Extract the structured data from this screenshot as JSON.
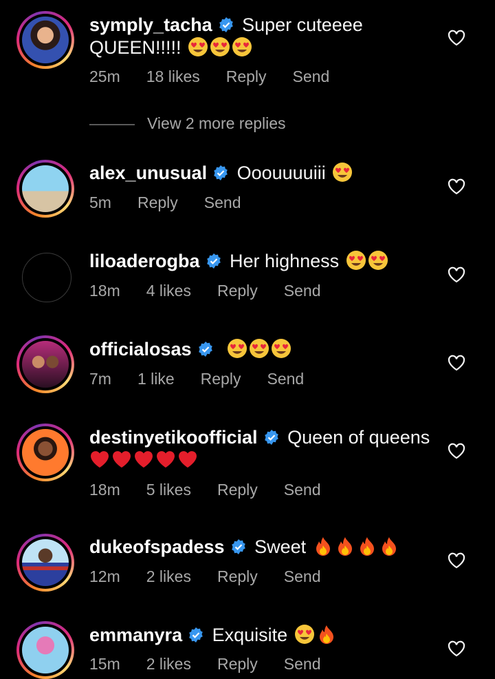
{
  "comments": [
    {
      "username": "symply_tacha",
      "text": "Super cuteeee QUEEN!!!!!",
      "emoji": [
        "heart-eyes",
        "heart-eyes",
        "heart-eyes"
      ],
      "time": "25m",
      "likes": "18 likes",
      "reply": "Reply",
      "send": "Send"
    },
    {
      "username": "alex_unusual",
      "text": "Ooouuuuiii",
      "emoji": [
        "heart-eyes"
      ],
      "time": "5m",
      "reply": "Reply",
      "send": "Send"
    },
    {
      "username": "liloaderogba",
      "text": "Her highness",
      "emoji": [
        "heart-eyes",
        "heart-eyes"
      ],
      "time": "18m",
      "likes": "4 likes",
      "reply": "Reply",
      "send": "Send"
    },
    {
      "username": "officialosas",
      "text": "",
      "emoji": [
        "heart-eyes",
        "heart-eyes",
        "heart-eyes"
      ],
      "time": "7m",
      "likes": "1 like",
      "reply": "Reply",
      "send": "Send"
    },
    {
      "username": "destinyetikoofficial",
      "text": "Queen of queens",
      "emoji": [
        "red-heart",
        "red-heart",
        "red-heart",
        "red-heart",
        "red-heart"
      ],
      "time": "18m",
      "likes": "5 likes",
      "reply": "Reply",
      "send": "Send"
    },
    {
      "username": "dukeofspadess",
      "text": "Sweet",
      "emoji": [
        "fire",
        "fire",
        "fire",
        "fire"
      ],
      "time": "12m",
      "likes": "2 likes",
      "reply": "Reply",
      "send": "Send"
    },
    {
      "username": "emmanyra",
      "text": "Exquisite",
      "emoji": [
        "heart-eyes",
        "fire"
      ],
      "time": "15m",
      "likes": "2 likes",
      "reply": "Reply",
      "send": "Send"
    }
  ],
  "view_replies": "View 2 more replies",
  "colors": {
    "background": "#000000",
    "meta": "#a8a8a8",
    "verified": "#3897f0",
    "story_ring": [
      "#f58529",
      "#dd2a7b",
      "#8134af"
    ]
  }
}
